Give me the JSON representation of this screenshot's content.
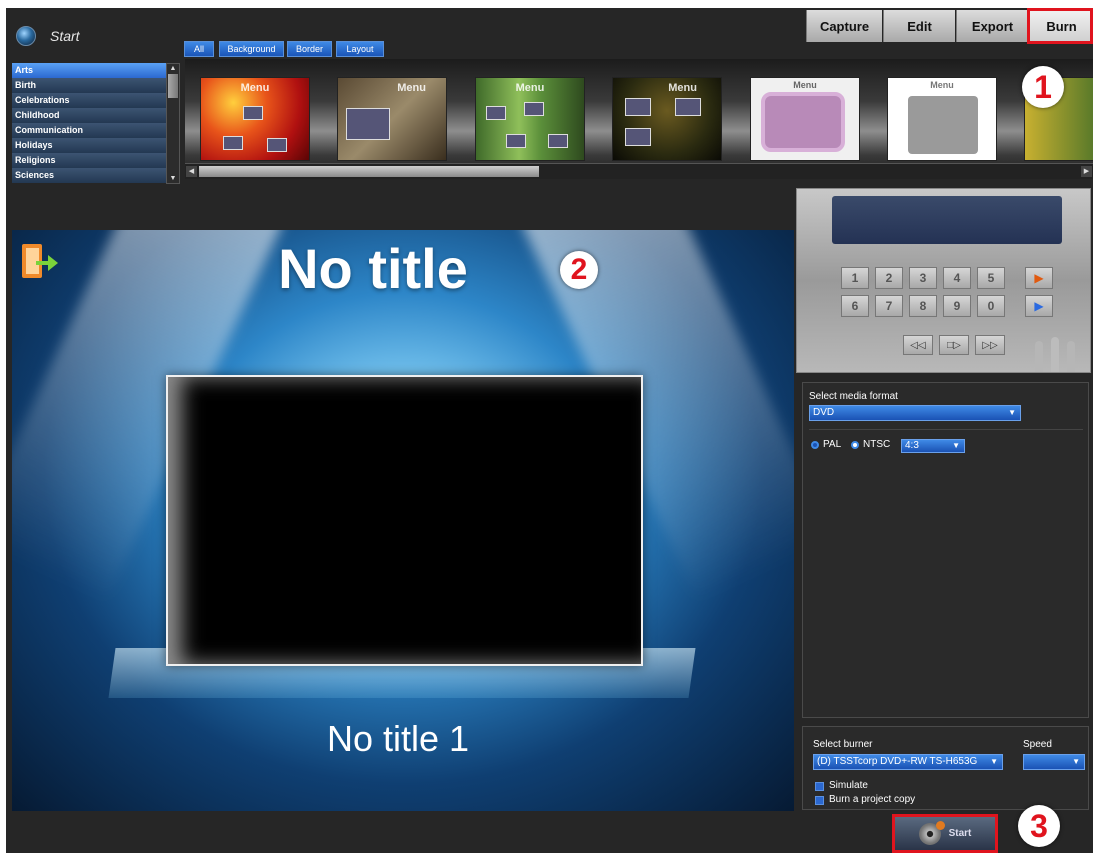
{
  "header": {
    "start_label": "Start",
    "tabs": [
      {
        "label": "Capture"
      },
      {
        "label": "Edit"
      },
      {
        "label": "Export"
      },
      {
        "label": "Burn"
      }
    ]
  },
  "filters": [
    "All",
    "Background",
    "Border",
    "Layout"
  ],
  "categories": [
    "Arts",
    "Birth",
    "Celebrations",
    "Childhood",
    "Communication",
    "Holidays",
    "Religions",
    "Sciences"
  ],
  "selected_category": "Arts",
  "themes": [
    {
      "menu_text": "Menu"
    },
    {
      "menu_text": "Menu"
    },
    {
      "menu_text": "Menu"
    },
    {
      "menu_text": "Menu"
    },
    {
      "menu_text": "Menu"
    },
    {
      "menu_text": "Menu"
    },
    {
      "menu_text": ""
    }
  ],
  "badges": {
    "one": "1",
    "two": "2",
    "three": "3"
  },
  "preview": {
    "title": "No title",
    "chapter": "No title 1"
  },
  "remote": {
    "keys_row1": [
      "1",
      "2",
      "3",
      "4",
      "5"
    ],
    "keys_row2": [
      "6",
      "7",
      "8",
      "9",
      "0"
    ],
    "play_glyph": "▶",
    "nav": [
      "◁◁",
      "□▷",
      "▷▷"
    ]
  },
  "format": {
    "label": "Select media format",
    "value": "DVD",
    "standard_pal": "PAL",
    "standard_ntsc": "NTSC",
    "aspect": "4:3"
  },
  "burn": {
    "burner_label": "Select burner",
    "burner_value": "(D) TSSTcorp DVD+-RW TS-H653G",
    "speed_label": "Speed",
    "speed_value": "",
    "simulate": "Simulate",
    "copy": "Burn a project copy",
    "start": "Start"
  },
  "colors": {
    "highlight": "#e0141e",
    "accent": "#3f8ae6"
  }
}
